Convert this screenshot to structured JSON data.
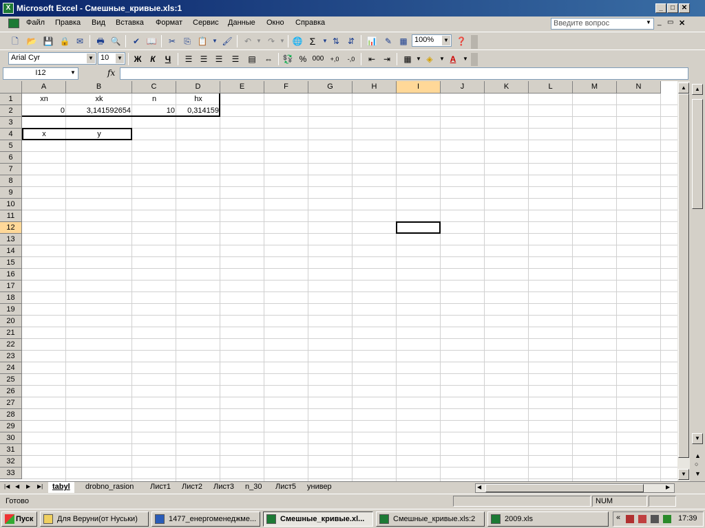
{
  "window": {
    "title": "Microsoft Excel - Смешные_кривые.xls:1"
  },
  "menu": {
    "items": [
      "Файл",
      "Правка",
      "Вид",
      "Вставка",
      "Формат",
      "Сервис",
      "Данные",
      "Окно",
      "Справка"
    ],
    "ask_placeholder": "Введите вопрос"
  },
  "toolbar": {
    "zoom": "100%",
    "font": "Arial Cyr",
    "size": "10",
    "bold": "Ж",
    "italic": "К",
    "underline": "Ч",
    "percent": "%",
    "thousands": "000",
    "sigma": "Σ"
  },
  "formula_bar": {
    "name_box": "I12",
    "fx": "fx",
    "content": ""
  },
  "columns": [
    "A",
    "B",
    "C",
    "D",
    "E",
    "F",
    "G",
    "H",
    "I",
    "J",
    "K",
    "L",
    "M",
    "N"
  ],
  "rows": [
    "1",
    "2",
    "3",
    "4",
    "5",
    "6",
    "7",
    "8",
    "9",
    "10",
    "11",
    "12",
    "13",
    "14",
    "15",
    "16",
    "17",
    "18",
    "19",
    "20",
    "21",
    "22",
    "23",
    "24",
    "25",
    "26",
    "27",
    "28",
    "29",
    "30",
    "31",
    "32",
    "33"
  ],
  "cells": {
    "A1": "xn",
    "B1": "xk",
    "C1": "n",
    "D1": "hx",
    "A2": "0",
    "B2": "3,141592654",
    "C2": "10",
    "D2": "0,314159",
    "A4": "x",
    "B4": "y"
  },
  "sheets": [
    "tabyl",
    "drobno_rasion",
    "Лист1",
    "Лист2",
    "Лист3",
    "n_30",
    "Лист5",
    "универ"
  ],
  "status": {
    "ready": "Готово",
    "num": "NUM"
  },
  "taskbar": {
    "start": "Пуск",
    "tasks": [
      "Для Веруни(от Нуськи)",
      "1477_енергоменеджме...",
      "Смешные_кривые.xl...",
      "Смешные_кривые.xls:2",
      "2009.xls"
    ],
    "clock": "17:39"
  }
}
